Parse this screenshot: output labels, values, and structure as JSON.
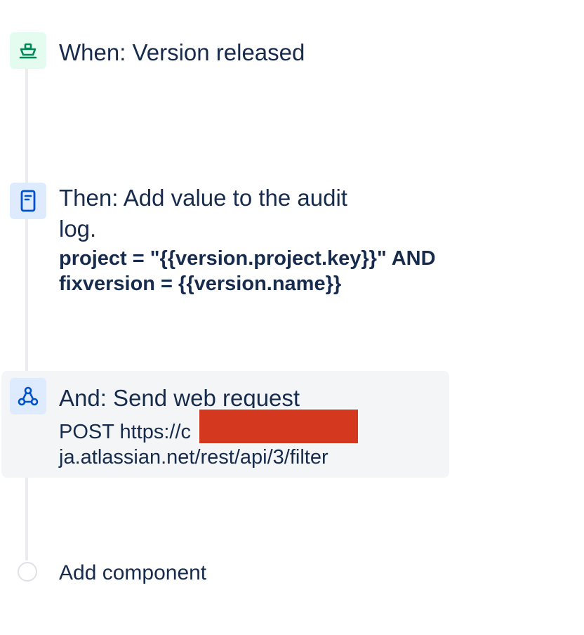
{
  "rule": {
    "trigger": {
      "title": "When: Version released",
      "icon": "ship-icon",
      "icon_color": "#00875a",
      "icon_bg": "#e3fcef"
    },
    "action_audit": {
      "title": "Then: Add value to the audit log.",
      "detail": "project = \"{{version.project.key}}\" AND fixversion = {{version.name}}",
      "icon": "document-icon",
      "icon_color": "#0052cc",
      "icon_bg": "#deebff"
    },
    "action_web": {
      "title": "And: Send web request",
      "detail": "POST https://c ja.atlassian.net/rest/api/3/filter",
      "icon": "webhook-icon",
      "icon_color": "#0052cc",
      "icon_bg": "#deebff",
      "redaction_color": "#d4391f"
    },
    "add_component": {
      "label": "Add component"
    }
  }
}
